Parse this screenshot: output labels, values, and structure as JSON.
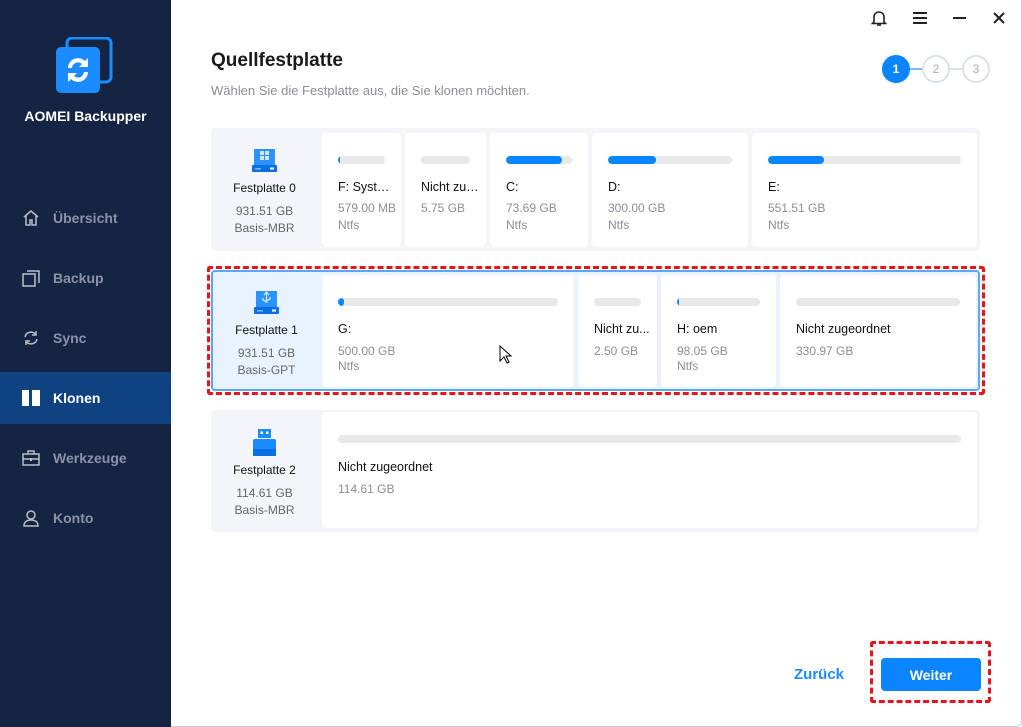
{
  "app": {
    "name": "AOMEI Backupper"
  },
  "sidebar": {
    "items": [
      {
        "label": "Übersicht",
        "icon": "home-icon",
        "active": false
      },
      {
        "label": "Backup",
        "icon": "backup-icon",
        "active": false
      },
      {
        "label": "Sync",
        "icon": "sync-icon",
        "active": false
      },
      {
        "label": "Klonen",
        "icon": "clone-icon",
        "active": true
      },
      {
        "label": "Werkzeuge",
        "icon": "toolbox-icon",
        "active": false
      },
      {
        "label": "Konto",
        "icon": "user-icon",
        "active": false
      }
    ]
  },
  "header": {
    "title": "Quellfestplatte",
    "subtitle": "Wählen Sie die Festplatte aus, die Sie klonen möchten."
  },
  "steps": {
    "items": [
      "1",
      "2",
      "3"
    ],
    "current": 1
  },
  "disks": [
    {
      "name": "Festplatte 0",
      "size": "931.51 GB",
      "type": "Basis-MBR",
      "icon": "windows-disk-icon",
      "selected": false,
      "partitions": [
        {
          "name": "F: System...",
          "size": "579.00 MB",
          "fs": "Ntfs",
          "used": 0.05
        },
        {
          "name": "Nicht zug...",
          "size": "5.75 GB",
          "fs": "",
          "used": 0
        },
        {
          "name": "C:",
          "size": "73.69 GB",
          "fs": "Ntfs",
          "used": 0.85
        },
        {
          "name": "D:",
          "size": "300.00 GB",
          "fs": "Ntfs",
          "used": 0.39
        },
        {
          "name": "E:",
          "size": "551.51 GB",
          "fs": "Ntfs",
          "used": 0.29
        }
      ]
    },
    {
      "name": "Festplatte 1",
      "size": "931.51 GB",
      "type": "Basis-GPT",
      "icon": "usb-disk-icon",
      "selected": true,
      "partitions": [
        {
          "name": "G:",
          "size": "500.00 GB",
          "fs": "Ntfs",
          "used": 0.01
        },
        {
          "name": "Nicht zu...",
          "size": "2.50 GB",
          "fs": "",
          "used": 0
        },
        {
          "name": "H: oem",
          "size": "98.05 GB",
          "fs": "Ntfs",
          "used": 0.03
        },
        {
          "name": "Nicht zugeordnet",
          "size": "330.97 GB",
          "fs": "",
          "used": 0
        }
      ]
    },
    {
      "name": "Festplatte 2",
      "size": "114.61 GB",
      "type": "Basis-MBR",
      "icon": "usb-drive-icon",
      "selected": false,
      "partitions": [
        {
          "name": "Nicht zugeordnet",
          "size": "114.61 GB",
          "fs": "",
          "used": 0
        }
      ]
    }
  ],
  "footer": {
    "back_label": "Zurück",
    "next_label": "Weiter"
  },
  "colors": {
    "accent": "#0a84ff",
    "sidebar": "#162443",
    "sidebar_active": "#0f4280",
    "highlight": "#e8141b"
  }
}
